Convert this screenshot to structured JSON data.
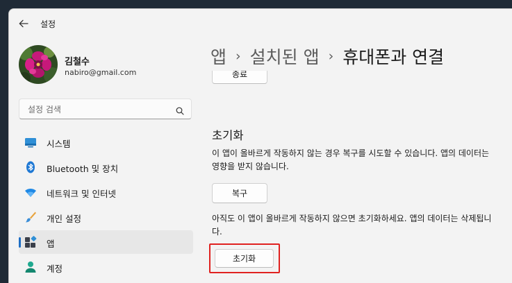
{
  "window": {
    "app_title": "설정"
  },
  "profile": {
    "name": "김철수",
    "email": "nabiro@gmail.com"
  },
  "search": {
    "placeholder": "설정 검색"
  },
  "nav": {
    "items": [
      {
        "label": "시스템",
        "icon": "system-icon"
      },
      {
        "label": "Bluetooth 및 장치",
        "icon": "bluetooth-icon"
      },
      {
        "label": "네트워크 및 인터넷",
        "icon": "wifi-icon"
      },
      {
        "label": "개인 설정",
        "icon": "brush-icon"
      },
      {
        "label": "앱",
        "icon": "apps-icon",
        "active": true
      },
      {
        "label": "계정",
        "icon": "account-icon"
      }
    ]
  },
  "breadcrumb": {
    "level1": "앱",
    "level2": "설치된 앱",
    "current": "휴대폰과 연결",
    "separator": "›"
  },
  "content": {
    "end_button_label": "종료",
    "reset_section_title": "초기화",
    "repair_description": "이 앱이 올바르게 작동하지 않는 경우 복구를 시도할 수 있습니다. 앱의 데이터는 영향을 받지 않습니다.",
    "repair_button_label": "복구",
    "reset_description": "아직도 이 앱이 올바르게 작동하지 않으면 초기화하세요. 앱의 데이터는 삭제됩니다.",
    "reset_button_label": "초기화"
  },
  "colors": {
    "accent": "#1f6fc5",
    "highlight": "#e0211f"
  }
}
